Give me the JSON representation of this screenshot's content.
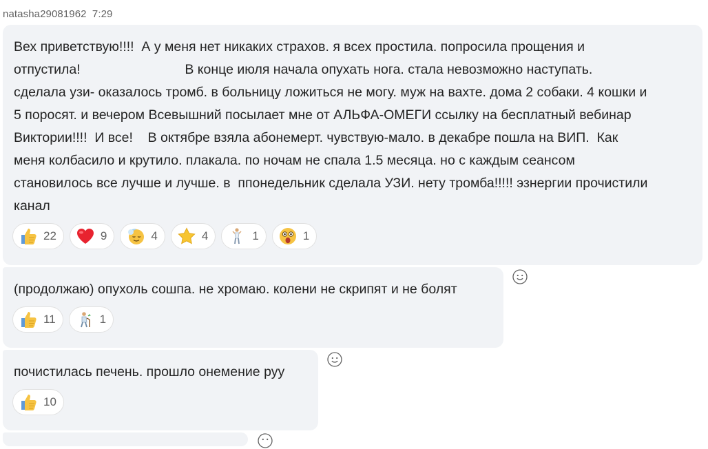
{
  "message_header": {
    "author": "natasha29081962",
    "time": "7:29"
  },
  "messages": [
    {
      "text": "Вех приветствую!!!!  А у меня нет никаких страхов. я всех простила. попросила прощения и\nотпустила!                            В конце июля начала опухать нога. стала невозможно наступать.\nсделала узи- оказалось тромб. в больницу ложиться не могу. муж на вахте. дома 2 собаки. 4 кошки и\n5 поросят. и вечером Всевышний посылает мне от АЛЬФА-ОМЕГИ ссылку на бесплатный вебинар\nВиктории!!!!  И все!    В октябре взяла абонемерт. чувствую-мало. в декабре пошла на ВИП.  Как\nменя колбасило и крутило. плакала. по ночам не спала 1.5 месяца. но с каждым сеансом\nстановилось все лучше и лучше. в  ппонедельник сделала УЗИ. нету тромба!!!!! эзнергии прочистили\nканал",
      "reactions": [
        {
          "icon": "thumbs-up-icon",
          "count": "22"
        },
        {
          "icon": "heart-icon",
          "count": "9"
        },
        {
          "icon": "relieved-face-icon",
          "count": "4"
        },
        {
          "icon": "star-icon",
          "count": "4"
        },
        {
          "icon": "person-figure-icon",
          "count": "1"
        },
        {
          "icon": "astonished-face-icon",
          "count": "1"
        }
      ]
    },
    {
      "text": "(продолжаю) опухоль сошпа. не хромаю. колени не скрипят и не болят",
      "reactions": [
        {
          "icon": "thumbs-up-icon",
          "count": "11"
        },
        {
          "icon": "elderly-walking-icon",
          "count": "1"
        }
      ]
    },
    {
      "text": "почистилась печень. прошло онемение руу",
      "reactions": [
        {
          "icon": "thumbs-up-icon",
          "count": "10"
        }
      ]
    }
  ],
  "colors": {
    "bubble": "#f1f3f6",
    "pill_border": "#e1e1e1",
    "text": "#242424",
    "meta": "#616161",
    "thumbs": "#f6c343",
    "heart": "#e8232f"
  }
}
